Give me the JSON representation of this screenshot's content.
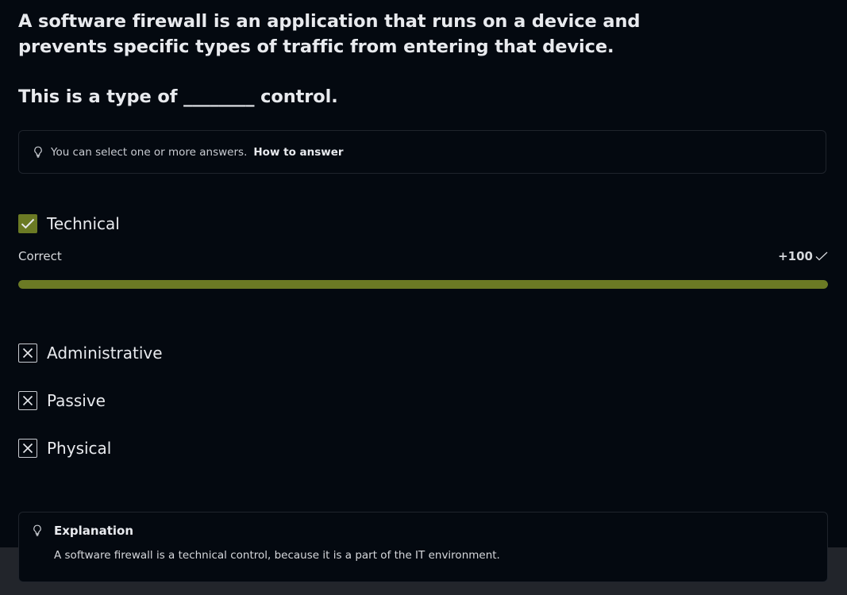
{
  "question": {
    "line1": "A software firewall is an application that runs on a device and",
    "line2": "prevents specific types of traffic from entering that device.",
    "line3": "This is a type of ________ control."
  },
  "hint": {
    "icon": "lightbulb-icon",
    "text": "You can select one or more answers.",
    "link": "How to answer"
  },
  "options": [
    {
      "label": "Technical",
      "state": "checked"
    },
    {
      "label": "Administrative",
      "state": "crossed"
    },
    {
      "label": "Passive",
      "state": "crossed"
    },
    {
      "label": "Physical",
      "state": "crossed"
    }
  ],
  "result": {
    "status": "Correct",
    "points": "+100",
    "progress": 1.0,
    "color": "#6b7a24"
  },
  "explanation": {
    "icon": "lightbulb-icon",
    "title": "Explanation",
    "text": "A software firewall is a technical control, because it is a part of the IT environment."
  }
}
